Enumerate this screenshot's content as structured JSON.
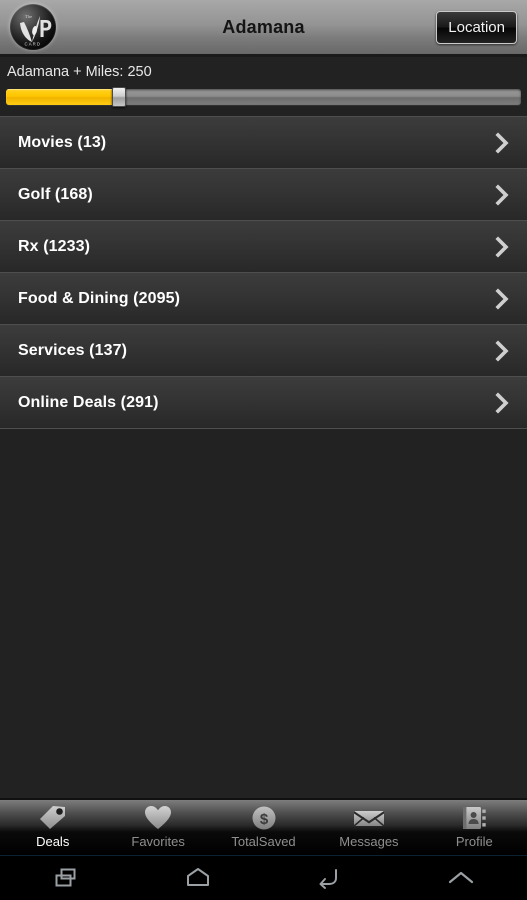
{
  "header": {
    "title": "Adamana",
    "logo_alt": "ViP CARD",
    "logo_text_top": "The",
    "logo_text_main": "ViP",
    "logo_text_bottom": "C A R D",
    "location_label": "Location"
  },
  "filter": {
    "label": "Adamana + Miles: 250",
    "value": 250,
    "percent": 21,
    "fill_color": "#ffc500",
    "track_color": "#8c8c8c"
  },
  "categories": [
    {
      "label": "Movies (13)",
      "name": "movies",
      "count": 13
    },
    {
      "label": "Golf (168)",
      "name": "golf",
      "count": 168
    },
    {
      "label": "Rx (1233)",
      "name": "rx",
      "count": 1233
    },
    {
      "label": "Food & Dining (2095)",
      "name": "food-dining",
      "count": 2095
    },
    {
      "label": "Services (137)",
      "name": "services",
      "count": 137
    },
    {
      "label": "Online Deals (291)",
      "name": "online-deals",
      "count": 291
    }
  ],
  "tabs": [
    {
      "label": "Deals",
      "icon": "price-tag-icon",
      "active": true
    },
    {
      "label": "Favorites",
      "icon": "heart-icon",
      "active": false
    },
    {
      "label": "TotalSaved",
      "icon": "dollar-coin-icon",
      "active": false
    },
    {
      "label": "Messages",
      "icon": "envelope-icon",
      "active": false
    },
    {
      "label": "Profile",
      "icon": "contact-book-icon",
      "active": false
    }
  ],
  "navbar": [
    {
      "name": "recents-button",
      "icon": "recents-icon"
    },
    {
      "name": "home-button",
      "icon": "home-icon"
    },
    {
      "name": "back-button",
      "icon": "back-arrow-icon"
    },
    {
      "name": "expand-button",
      "icon": "chevron-up-icon"
    }
  ],
  "colors": {
    "background": "#222222",
    "row_top": "#3c3c3c",
    "row_bottom": "#282828",
    "accent_yellow": "#ffc500",
    "active_tab_text": "#ffffff",
    "inactive_tab_text": "#8f8f8f"
  }
}
